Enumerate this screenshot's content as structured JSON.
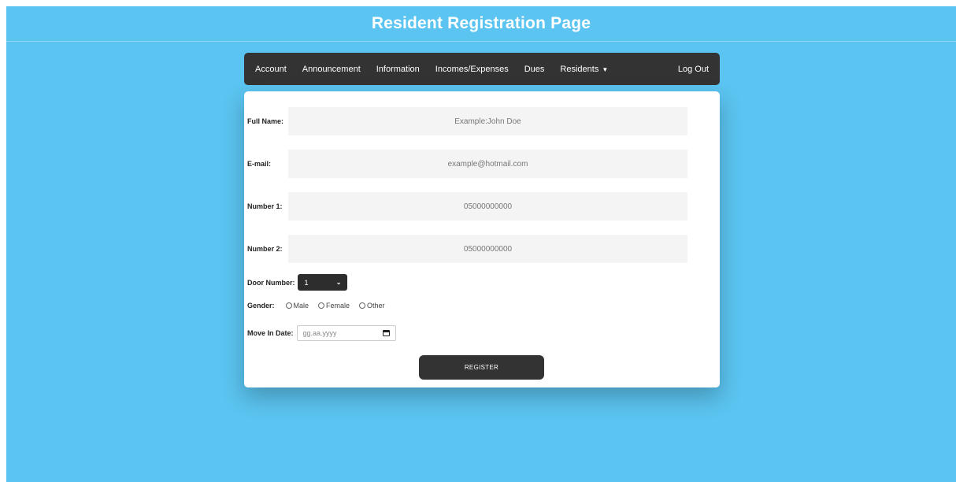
{
  "header": {
    "title": "Resident Registration Page"
  },
  "nav": {
    "items": [
      {
        "label": "Account"
      },
      {
        "label": "Announcement"
      },
      {
        "label": "Information"
      },
      {
        "label": "Incomes/Expenses"
      },
      {
        "label": "Dues"
      },
      {
        "label": "Residents"
      }
    ],
    "logout": "Log Out"
  },
  "form": {
    "full_name": {
      "label": "Full Name:",
      "placeholder": "Example:John Doe"
    },
    "email": {
      "label": "E-mail:",
      "placeholder": "example@hotmail.com"
    },
    "number1": {
      "label": "Number 1:",
      "placeholder": "05000000000"
    },
    "number2": {
      "label": "Number 2:",
      "placeholder": "05000000000"
    },
    "door": {
      "label": "Door Number:",
      "value": "1"
    },
    "gender": {
      "label": "Gender:",
      "options": [
        "Male",
        "Female",
        "Other"
      ]
    },
    "move_in": {
      "label": "Move In Date:",
      "placeholder": "gg.aa.yyyy"
    },
    "submit_label": "REGISTER"
  },
  "colors": {
    "page_background": "#5bc4f0",
    "navbar": "#333333",
    "button": "#333333"
  },
  "icons": {
    "residents_dropdown": "caret-down-icon",
    "door_select": "chevron-down-icon",
    "date_picker": "calendar-icon"
  }
}
